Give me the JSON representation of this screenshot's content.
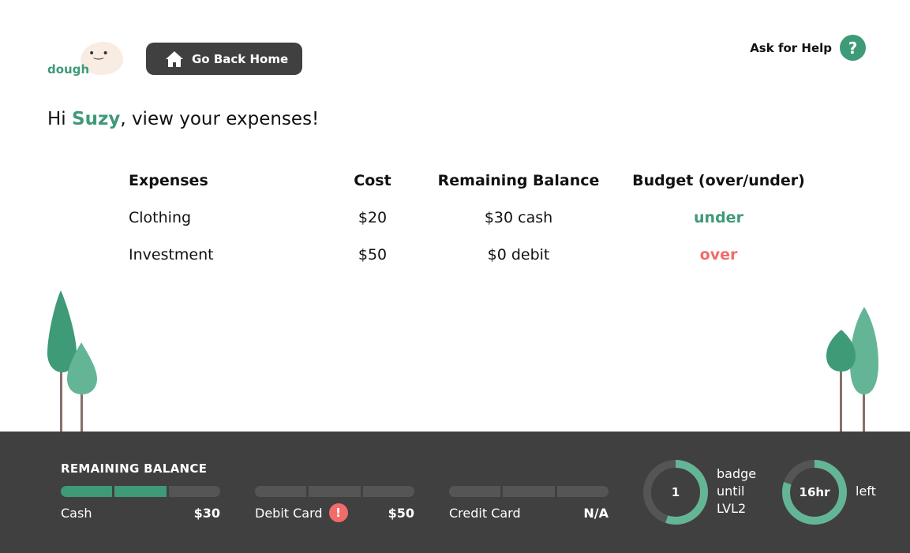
{
  "logo": {
    "wordmark": "dough",
    "face": "•‿•"
  },
  "header": {
    "home_button": "Go Back Home",
    "help_label": "Ask for Help",
    "help_glyph": "?"
  },
  "greeting": {
    "prefix": "Hi ",
    "name": "Suzy",
    "suffix": ", view your expenses!"
  },
  "expenses": {
    "columns": [
      "Expenses",
      "Cost",
      "Remaining Balance",
      "Budget (over/under)"
    ],
    "rows": [
      {
        "expense": "Clothing",
        "cost": "$20",
        "remaining": "$30 cash",
        "budget": "under",
        "budget_status": "under"
      },
      {
        "expense": "Investment",
        "cost": "$50",
        "remaining": "$0 debit",
        "budget": "over",
        "budget_status": "over"
      }
    ]
  },
  "balance_bar": {
    "title": "REMAINING BALANCE",
    "accounts": [
      {
        "label": "Cash",
        "amount": "$30",
        "filled_segments": 2,
        "total_segments": 3,
        "alert": false
      },
      {
        "label": "Debit Card",
        "amount": "$50",
        "filled_segments": 0,
        "total_segments": 3,
        "alert": true,
        "alert_glyph": "!"
      },
      {
        "label": "Credit Card",
        "amount": "N/A",
        "filled_segments": 0,
        "total_segments": 3,
        "alert": false
      }
    ],
    "badge_ring": {
      "value": "1",
      "label_lines": [
        "badge",
        "until",
        "LVL2"
      ],
      "progress": 0.55
    },
    "time_ring": {
      "value": "16hr",
      "label": "left",
      "progress": 0.8
    }
  },
  "colors": {
    "brand_green": "#3e9a77",
    "light_green": "#64b596",
    "alert_red": "#f16b6b",
    "dark_bar": "#404040",
    "track": "#555555",
    "trunk": "#8a6f68"
  }
}
